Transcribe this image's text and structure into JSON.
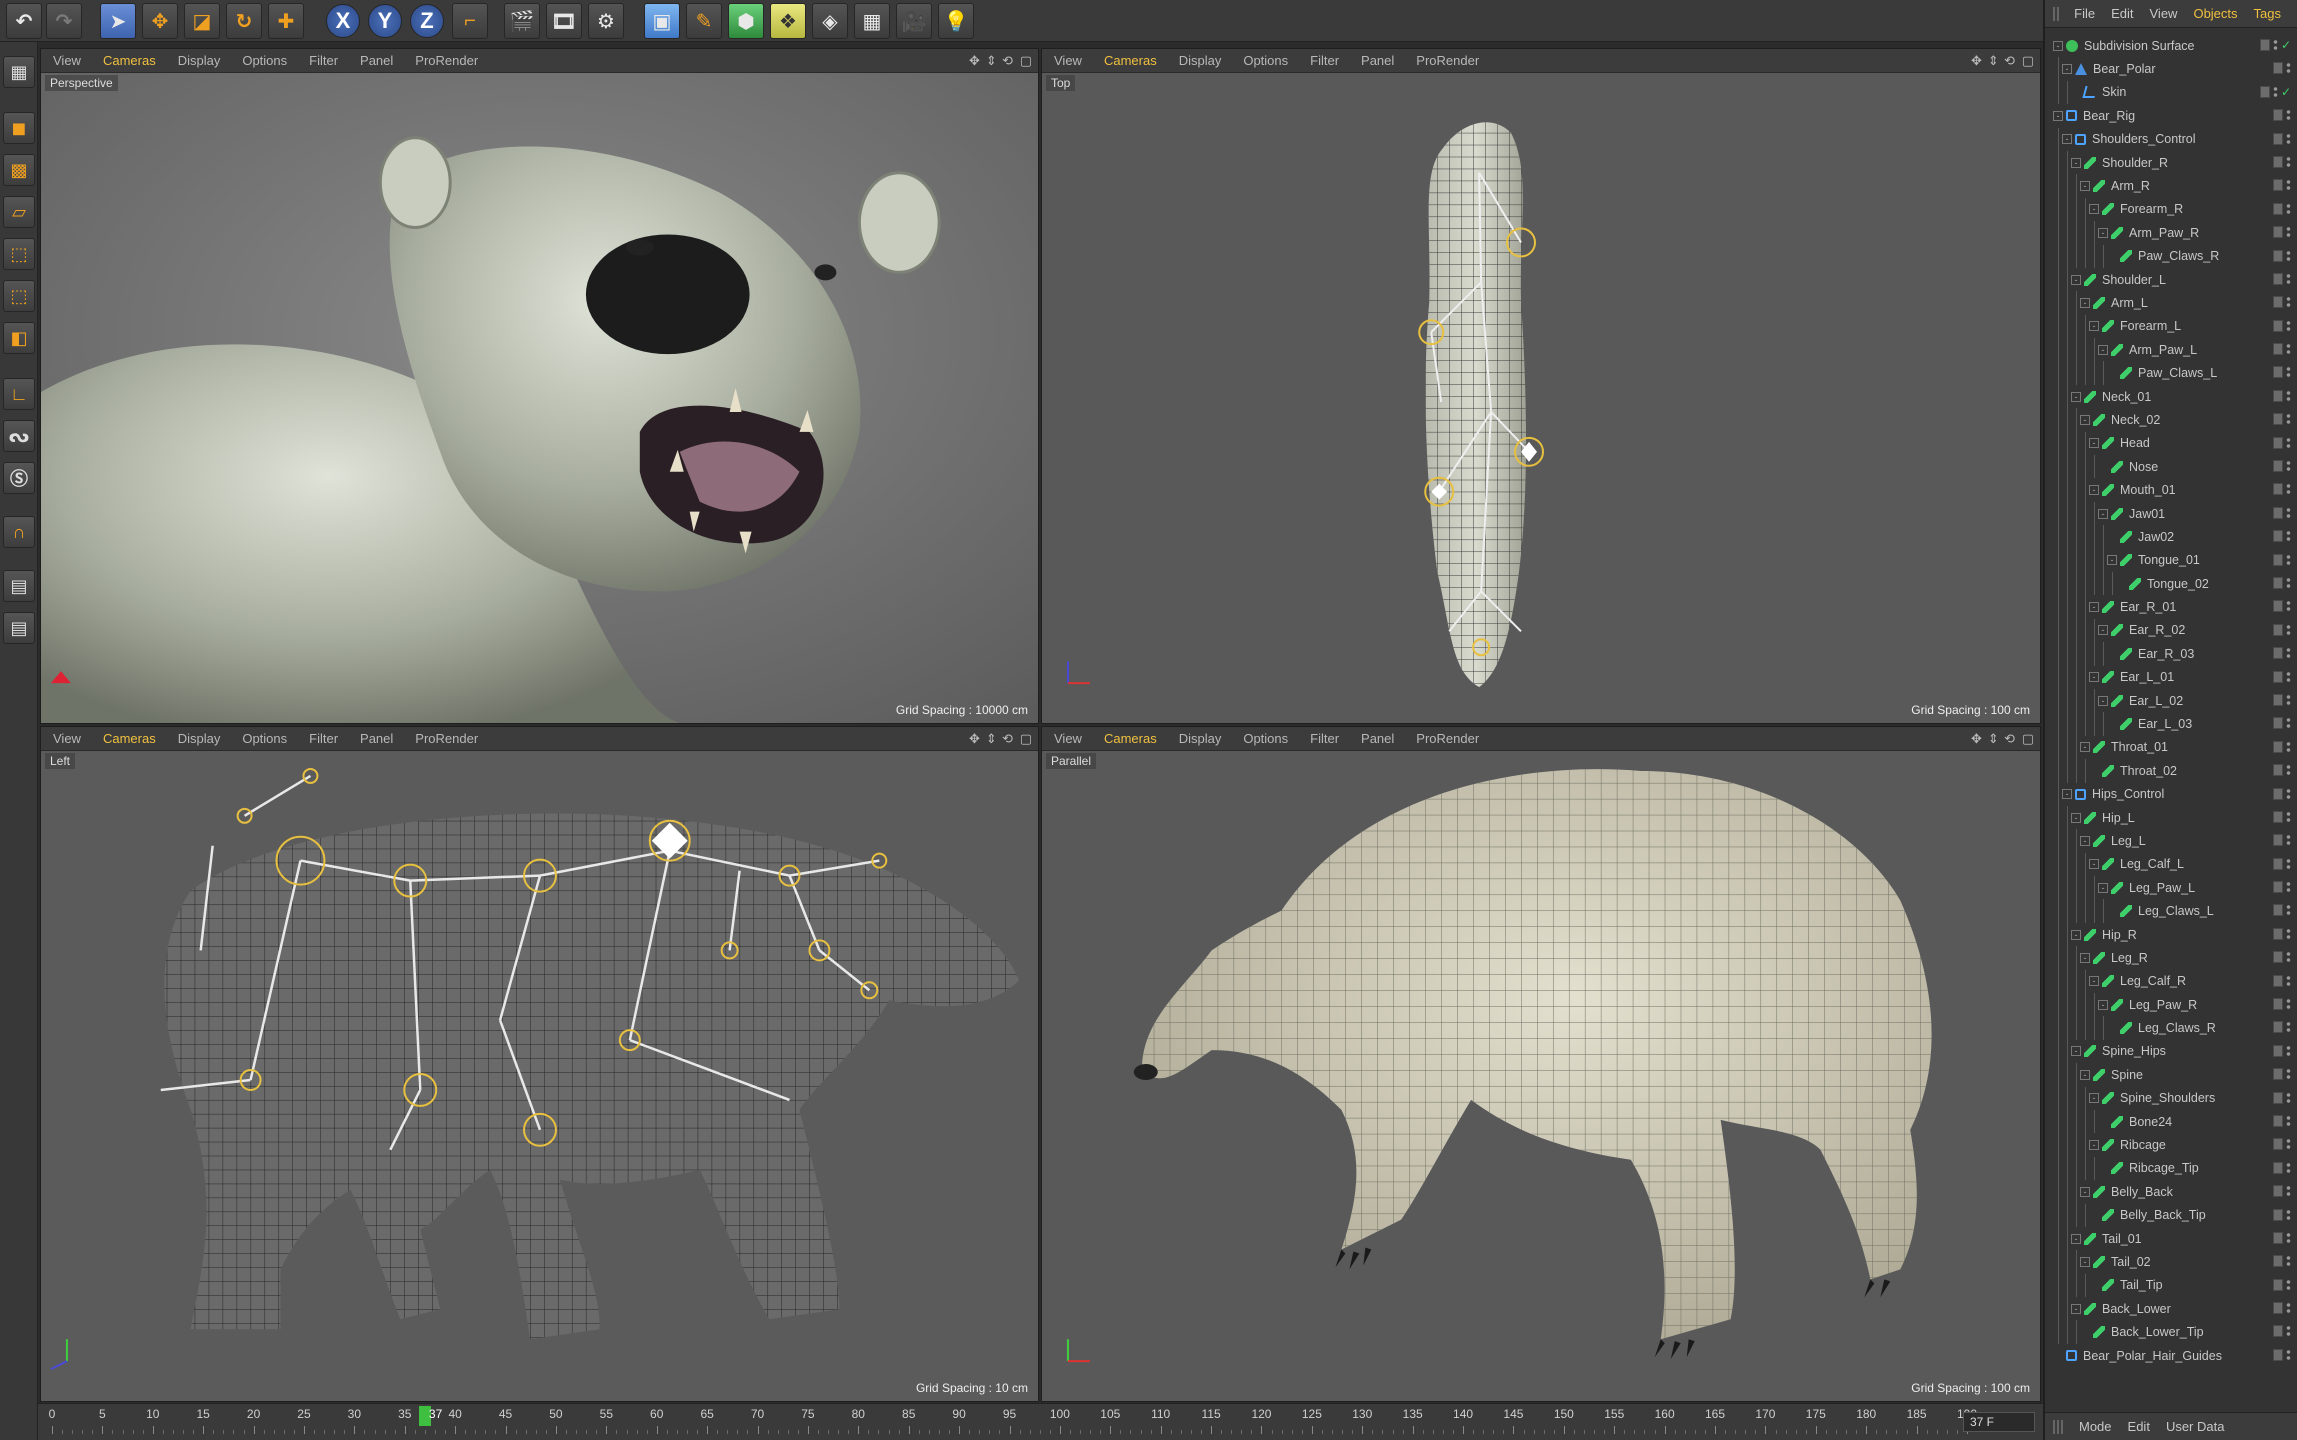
{
  "toolbar": {
    "buttons": [
      "undo-icon",
      "redo-icon",
      "select-icon",
      "move-icon",
      "scale-icon",
      "rotate-icon",
      "live-selection-icon",
      "x-axis-lock",
      "y-axis-lock",
      "z-axis-lock",
      "coordinate-system-icon",
      "render-view-icon",
      "render-picture-viewer-icon",
      "render-settings-icon",
      "cube-icon",
      "pen-icon",
      "subdivision-icon",
      "array-icon",
      "deformer-icon",
      "floor-icon",
      "camera-icon",
      "light-icon"
    ],
    "x": "X",
    "y": "Y",
    "z": "Z"
  },
  "viewport_menu": [
    "View",
    "Cameras",
    "Display",
    "Options",
    "Filter",
    "Panel",
    "ProRender"
  ],
  "viewports": [
    {
      "label": "Perspective",
      "grid": "Grid Spacing : 10000 cm"
    },
    {
      "label": "Top",
      "grid": "Grid Spacing : 100 cm"
    },
    {
      "label": "Left",
      "grid": "Grid Spacing : 10 cm"
    },
    {
      "label": "Parallel",
      "grid": "Grid Spacing : 100 cm"
    }
  ],
  "timeline": {
    "ticks": [
      "0",
      "5",
      "10",
      "15",
      "20",
      "25",
      "30",
      "35",
      "40",
      "45",
      "50",
      "55",
      "60",
      "65",
      "70",
      "75",
      "80",
      "85",
      "90",
      "95",
      "100",
      "105",
      "110",
      "115",
      "120",
      "125",
      "130",
      "135",
      "140",
      "145",
      "150",
      "155",
      "160",
      "165",
      "170",
      "175",
      "180",
      "185",
      "190"
    ],
    "current_frame": "37",
    "frame_field": "37 F"
  },
  "object_manager": {
    "menu": [
      "File",
      "Edit",
      "View",
      "Objects",
      "Tags"
    ],
    "footer": [
      "Mode",
      "Edit",
      "User Data"
    ],
    "tree": [
      {
        "name": "Subdivision Surface",
        "depth": 0,
        "icon": "subd",
        "exp": "-",
        "check": true
      },
      {
        "name": "Bear_Polar",
        "depth": 1,
        "icon": "poly",
        "exp": "-"
      },
      {
        "name": "Skin",
        "depth": 2,
        "icon": "skin",
        "exp": "",
        "check": true
      },
      {
        "name": "Bear_Rig",
        "depth": 0,
        "icon": "null",
        "exp": "-"
      },
      {
        "name": "Shoulders_Control",
        "depth": 1,
        "icon": "null",
        "exp": "-"
      },
      {
        "name": "Shoulder_R",
        "depth": 2,
        "icon": "joint",
        "exp": "-"
      },
      {
        "name": "Arm_R",
        "depth": 3,
        "icon": "joint",
        "exp": "-"
      },
      {
        "name": "Forearm_R",
        "depth": 4,
        "icon": "joint",
        "exp": "-"
      },
      {
        "name": "Arm_Paw_R",
        "depth": 5,
        "icon": "joint",
        "exp": "-"
      },
      {
        "name": "Paw_Claws_R",
        "depth": 6,
        "icon": "joint",
        "exp": ""
      },
      {
        "name": "Shoulder_L",
        "depth": 2,
        "icon": "joint",
        "exp": "-"
      },
      {
        "name": "Arm_L",
        "depth": 3,
        "icon": "joint",
        "exp": "-"
      },
      {
        "name": "Forearm_L",
        "depth": 4,
        "icon": "joint",
        "exp": "-"
      },
      {
        "name": "Arm_Paw_L",
        "depth": 5,
        "icon": "joint",
        "exp": "-"
      },
      {
        "name": "Paw_Claws_L",
        "depth": 6,
        "icon": "joint",
        "exp": ""
      },
      {
        "name": "Neck_01",
        "depth": 2,
        "icon": "joint",
        "exp": "-"
      },
      {
        "name": "Neck_02",
        "depth": 3,
        "icon": "joint",
        "exp": "-"
      },
      {
        "name": "Head",
        "depth": 4,
        "icon": "joint",
        "exp": "-"
      },
      {
        "name": "Nose",
        "depth": 5,
        "icon": "joint",
        "exp": ""
      },
      {
        "name": "Mouth_01",
        "depth": 4,
        "icon": "joint",
        "exp": "-"
      },
      {
        "name": "Jaw01",
        "depth": 5,
        "icon": "joint",
        "exp": "-"
      },
      {
        "name": "Jaw02",
        "depth": 6,
        "icon": "joint",
        "exp": ""
      },
      {
        "name": "Tongue_01",
        "depth": 6,
        "icon": "joint",
        "exp": "-"
      },
      {
        "name": "Tongue_02",
        "depth": 7,
        "icon": "joint",
        "exp": ""
      },
      {
        "name": "Ear_R_01",
        "depth": 4,
        "icon": "joint",
        "exp": "-"
      },
      {
        "name": "Ear_R_02",
        "depth": 5,
        "icon": "joint",
        "exp": "-"
      },
      {
        "name": "Ear_R_03",
        "depth": 6,
        "icon": "joint",
        "exp": ""
      },
      {
        "name": "Ear_L_01",
        "depth": 4,
        "icon": "joint",
        "exp": "-"
      },
      {
        "name": "Ear_L_02",
        "depth": 5,
        "icon": "joint",
        "exp": "-"
      },
      {
        "name": "Ear_L_03",
        "depth": 6,
        "icon": "joint",
        "exp": ""
      },
      {
        "name": "Throat_01",
        "depth": 3,
        "icon": "joint",
        "exp": "-"
      },
      {
        "name": "Throat_02",
        "depth": 4,
        "icon": "joint",
        "exp": ""
      },
      {
        "name": "Hips_Control",
        "depth": 1,
        "icon": "null",
        "exp": "-"
      },
      {
        "name": "Hip_L",
        "depth": 2,
        "icon": "joint",
        "exp": "-"
      },
      {
        "name": "Leg_L",
        "depth": 3,
        "icon": "joint",
        "exp": "-"
      },
      {
        "name": "Leg_Calf_L",
        "depth": 4,
        "icon": "joint",
        "exp": "-"
      },
      {
        "name": "Leg_Paw_L",
        "depth": 5,
        "icon": "joint",
        "exp": "-"
      },
      {
        "name": "Leg_Claws_L",
        "depth": 6,
        "icon": "joint",
        "exp": ""
      },
      {
        "name": "Hip_R",
        "depth": 2,
        "icon": "joint",
        "exp": "-"
      },
      {
        "name": "Leg_R",
        "depth": 3,
        "icon": "joint",
        "exp": "-"
      },
      {
        "name": "Leg_Calf_R",
        "depth": 4,
        "icon": "joint",
        "exp": "-"
      },
      {
        "name": "Leg_Paw_R",
        "depth": 5,
        "icon": "joint",
        "exp": "-"
      },
      {
        "name": "Leg_Claws_R",
        "depth": 6,
        "icon": "joint",
        "exp": ""
      },
      {
        "name": "Spine_Hips",
        "depth": 2,
        "icon": "joint",
        "exp": "-"
      },
      {
        "name": "Spine",
        "depth": 3,
        "icon": "joint",
        "exp": "-"
      },
      {
        "name": "Spine_Shoulders",
        "depth": 4,
        "icon": "joint",
        "exp": "-"
      },
      {
        "name": "Bone24",
        "depth": 5,
        "icon": "joint",
        "exp": ""
      },
      {
        "name": "Ribcage",
        "depth": 4,
        "icon": "joint",
        "exp": "-"
      },
      {
        "name": "Ribcage_Tip",
        "depth": 5,
        "icon": "joint",
        "exp": ""
      },
      {
        "name": "Belly_Back",
        "depth": 3,
        "icon": "joint",
        "exp": "-"
      },
      {
        "name": "Belly_Back_Tip",
        "depth": 4,
        "icon": "joint",
        "exp": ""
      },
      {
        "name": "Tail_01",
        "depth": 2,
        "icon": "joint",
        "exp": "-"
      },
      {
        "name": "Tail_02",
        "depth": 3,
        "icon": "joint",
        "exp": "-"
      },
      {
        "name": "Tail_Tip",
        "depth": 4,
        "icon": "joint",
        "exp": ""
      },
      {
        "name": "Back_Lower",
        "depth": 2,
        "icon": "joint",
        "exp": "-"
      },
      {
        "name": "Back_Lower_Tip",
        "depth": 3,
        "icon": "joint",
        "exp": ""
      },
      {
        "name": "Bear_Polar_Hair_Guides",
        "depth": 0,
        "icon": "null",
        "exp": ""
      }
    ]
  },
  "colors": {
    "accent": "#f0c040",
    "joint": "#3fcf6a",
    "null": "#4da3ff",
    "background": "#2b2b2b"
  }
}
